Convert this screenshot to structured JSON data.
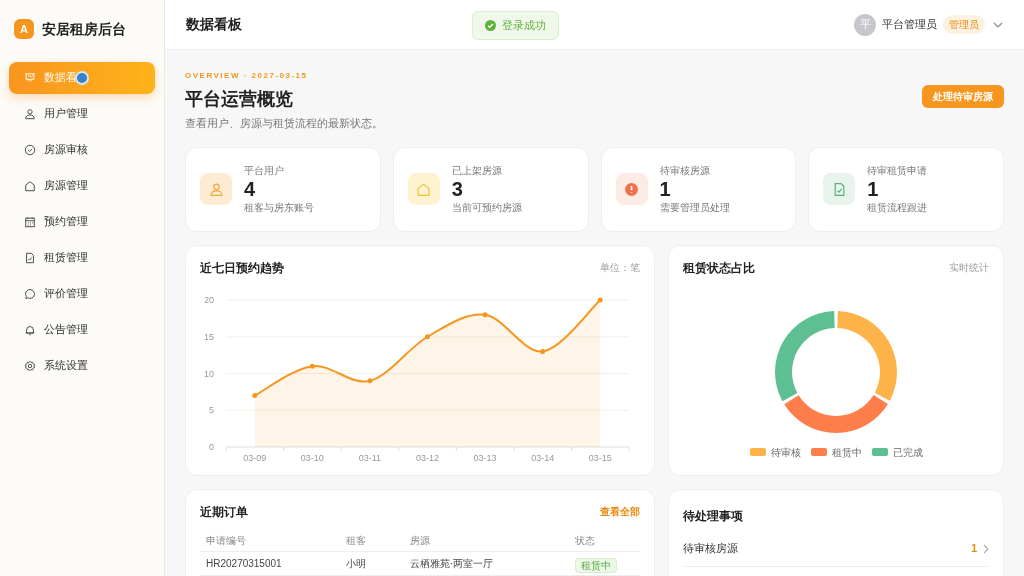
{
  "brand": {
    "logo": "A",
    "name": "安居租房后台"
  },
  "sidebar": {
    "items": [
      {
        "label": "数据看",
        "selected": true
      },
      {
        "label": "用户管理",
        "selected": false
      },
      {
        "label": "房源审核",
        "selected": false
      },
      {
        "label": "房源管理",
        "selected": false
      },
      {
        "label": "预约管理",
        "selected": false
      },
      {
        "label": "租赁管理",
        "selected": false
      },
      {
        "label": "评价管理",
        "selected": false
      },
      {
        "label": "公告管理",
        "selected": false
      },
      {
        "label": "系统设置",
        "selected": false
      }
    ]
  },
  "header": {
    "title": "数据看板",
    "toast": "登录成功",
    "user": {
      "avatar": "平",
      "name": "平台管理员",
      "role": "管理员"
    }
  },
  "overview": {
    "eyebrow": "OVERVIEW · 2027-03-15",
    "title": "平台运营概览",
    "subtitle": "查看用户、房源与租赁流程的最新状态。",
    "action": "处理待审房源"
  },
  "stats": [
    {
      "label": "平台用户",
      "value": "4",
      "note": "租客与房东账号",
      "color": "#fdebd3"
    },
    {
      "label": "已上架房源",
      "value": "3",
      "note": "当前可预约房源",
      "color": "#fdf3d0"
    },
    {
      "label": "待审核房源",
      "value": "1",
      "note": "需要管理员处理",
      "color": "#fdebe5"
    },
    {
      "label": "待审租赁申请",
      "value": "1",
      "note": "租赁流程跟进",
      "color": "#e6f4ec"
    }
  ],
  "trend": {
    "title": "近七日预约趋势",
    "unit": "单位：笔",
    "chart_data": {
      "type": "area",
      "categories": [
        "03-09",
        "03-10",
        "03-11",
        "03-12",
        "03-13",
        "03-14",
        "03-15"
      ],
      "series": [
        {
          "color": "#f7961e",
          "values": [
            7,
            11,
            9,
            15,
            18,
            13,
            20
          ]
        }
      ],
      "ylim": [
        0,
        20
      ],
      "yticks": [
        0,
        5,
        10,
        15,
        20
      ],
      "grid": true
    }
  },
  "status": {
    "title": "租赁状态占比",
    "note": "实时统计",
    "chart_data": {
      "type": "donut",
      "categories": [
        "待审核",
        "租赁中",
        "已完成"
      ],
      "series": [
        {
          "values": [
            33.3,
            33.3,
            33.4
          ]
        }
      ],
      "colors": [
        "#fdb34a",
        "#fd7d4b",
        "#5dbf92"
      ]
    }
  },
  "orders": {
    "title": "近期订单",
    "link": "查看全部",
    "columns": [
      "申请编号",
      "租客",
      "房源",
      "状态"
    ],
    "rows": [
      {
        "cells": [
          "HR20270315001",
          "小明",
          "云栖雅苑·两室一厅"
        ],
        "status": "租赁中"
      }
    ]
  },
  "todo": {
    "title": "待处理事项",
    "items": [
      {
        "label": "待审核房源",
        "count": "1"
      }
    ]
  }
}
